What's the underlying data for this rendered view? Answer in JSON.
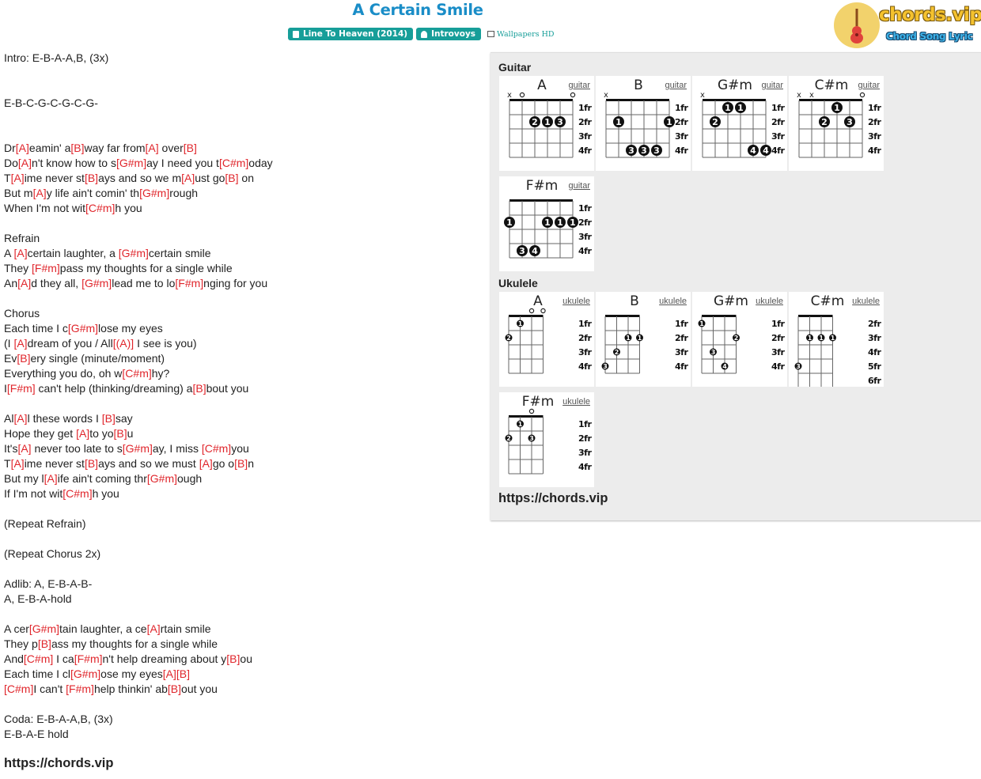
{
  "page": {
    "title": "A Certain Smile",
    "album": "Line To Heaven (2014)",
    "artist": "Introvoys",
    "wallpapers": "Wallpapers HD"
  },
  "brand": {
    "logo_text": "chords.vip",
    "tagline": "Chord Song Lyric"
  },
  "lyrics": [
    [
      [
        "Intro: E-B-A-A,B, (3x)",
        0
      ]
    ],
    [],
    [],
    [
      [
        "E-B-C-G-C-G-C-G-",
        0
      ]
    ],
    [],
    [],
    [
      [
        "Dr",
        0
      ],
      [
        "[A]",
        1
      ],
      [
        "eamin' a",
        0
      ],
      [
        "[B]",
        1
      ],
      [
        "way far from",
        0
      ],
      [
        "[A]",
        1
      ],
      [
        " over",
        0
      ],
      [
        "[B]",
        1
      ]
    ],
    [
      [
        "Do",
        0
      ],
      [
        "[A]",
        1
      ],
      [
        "n't know how to s",
        0
      ],
      [
        "[G#m]",
        1
      ],
      [
        "ay I need you t",
        0
      ],
      [
        "[C#m]",
        1
      ],
      [
        "oday",
        0
      ]
    ],
    [
      [
        "T",
        0
      ],
      [
        "[A]",
        1
      ],
      [
        "ime never st",
        0
      ],
      [
        "[B]",
        1
      ],
      [
        "ays and so we m",
        0
      ],
      [
        "[A]",
        1
      ],
      [
        "ust go",
        0
      ],
      [
        "[B]",
        1
      ],
      [
        " on",
        0
      ]
    ],
    [
      [
        "But m",
        0
      ],
      [
        "[A]",
        1
      ],
      [
        "y life ain't comin' th",
        0
      ],
      [
        "[G#m]",
        1
      ],
      [
        "rough",
        0
      ]
    ],
    [
      [
        "When I'm not wit",
        0
      ],
      [
        "[C#m]",
        1
      ],
      [
        "h you",
        0
      ]
    ],
    [],
    [
      [
        "Refrain",
        0
      ]
    ],
    [
      [
        "A ",
        0
      ],
      [
        "[A]",
        1
      ],
      [
        "certain laughter, a ",
        0
      ],
      [
        "[G#m]",
        1
      ],
      [
        "certain smile",
        0
      ]
    ],
    [
      [
        "They ",
        0
      ],
      [
        "[F#m]",
        1
      ],
      [
        "pass my thoughts for a single while",
        0
      ]
    ],
    [
      [
        "An",
        0
      ],
      [
        "[A]",
        1
      ],
      [
        "d they all, ",
        0
      ],
      [
        "[G#m]",
        1
      ],
      [
        "lead me to lo",
        0
      ],
      [
        "[F#m]",
        1
      ],
      [
        "nging for you",
        0
      ]
    ],
    [],
    [
      [
        "Chorus",
        0
      ]
    ],
    [
      [
        "Each time I c",
        0
      ],
      [
        "[G#m]",
        1
      ],
      [
        "lose my eyes",
        0
      ]
    ],
    [
      [
        "(I ",
        0
      ],
      [
        "[A]",
        1
      ],
      [
        "dream of you / All",
        0
      ],
      [
        "[(A)]",
        1
      ],
      [
        " I see is you)",
        0
      ]
    ],
    [
      [
        "Ev",
        0
      ],
      [
        "[B]",
        1
      ],
      [
        "ery single (minute/moment)",
        0
      ]
    ],
    [
      [
        "Everything you do, oh w",
        0
      ],
      [
        "[C#m]",
        1
      ],
      [
        "hy?",
        0
      ]
    ],
    [
      [
        "I",
        0
      ],
      [
        "[F#m]",
        1
      ],
      [
        " can't help (thinking/dreaming) a",
        0
      ],
      [
        "[B]",
        1
      ],
      [
        "bout you",
        0
      ]
    ],
    [],
    [
      [
        "Al",
        0
      ],
      [
        "[A]",
        1
      ],
      [
        "l these words I ",
        0
      ],
      [
        "[B]",
        1
      ],
      [
        "say",
        0
      ]
    ],
    [
      [
        "Hope they get ",
        0
      ],
      [
        "[A]",
        1
      ],
      [
        "to yo",
        0
      ],
      [
        "[B]",
        1
      ],
      [
        "u",
        0
      ]
    ],
    [
      [
        "It's",
        0
      ],
      [
        "[A]",
        1
      ],
      [
        " never too late to s",
        0
      ],
      [
        "[G#m]",
        1
      ],
      [
        "ay, I miss ",
        0
      ],
      [
        "[C#m]",
        1
      ],
      [
        "you",
        0
      ]
    ],
    [
      [
        "T",
        0
      ],
      [
        "[A]",
        1
      ],
      [
        "ime never st",
        0
      ],
      [
        "[B]",
        1
      ],
      [
        "ays and so we must ",
        0
      ],
      [
        "[A]",
        1
      ],
      [
        "go o",
        0
      ],
      [
        "[B]",
        1
      ],
      [
        "n",
        0
      ]
    ],
    [
      [
        "But my l",
        0
      ],
      [
        "[A]",
        1
      ],
      [
        "ife ain't coming thr",
        0
      ],
      [
        "[G#m]",
        1
      ],
      [
        "ough",
        0
      ]
    ],
    [
      [
        "If I'm not wit",
        0
      ],
      [
        "[C#m]",
        1
      ],
      [
        "h you",
        0
      ]
    ],
    [],
    [
      [
        "(Repeat Refrain)",
        0
      ]
    ],
    [],
    [
      [
        "(Repeat Chorus 2x)",
        0
      ]
    ],
    [],
    [
      [
        "Adlib: A, E-B-A-B-",
        0
      ]
    ],
    [
      [
        "A, E-B-A-hold",
        0
      ]
    ],
    [],
    [
      [
        "A cer",
        0
      ],
      [
        "[G#m]",
        1
      ],
      [
        "tain laughter, a ce",
        0
      ],
      [
        "[A]",
        1
      ],
      [
        "rtain smile",
        0
      ]
    ],
    [
      [
        "They p",
        0
      ],
      [
        "[B]",
        1
      ],
      [
        "ass my thoughts for a single while",
        0
      ]
    ],
    [
      [
        "And",
        0
      ],
      [
        "[C#m]",
        1
      ],
      [
        " I ca",
        0
      ],
      [
        "[F#m]",
        1
      ],
      [
        "n't help dreaming about y",
        0
      ],
      [
        "[B]",
        1
      ],
      [
        "ou",
        0
      ]
    ],
    [
      [
        "Each time I cl",
        0
      ],
      [
        "[G#m]",
        1
      ],
      [
        "ose my eyes",
        0
      ],
      [
        "[A]",
        1
      ],
      [
        "[B]",
        1
      ]
    ],
    [
      [
        "[C#m]",
        1
      ],
      [
        "I can't ",
        0
      ],
      [
        "[F#m]",
        1
      ],
      [
        "help thinkin' ab",
        0
      ],
      [
        "[B]",
        1
      ],
      [
        "out you",
        0
      ]
    ],
    [],
    [
      [
        "Coda: E-B-A-A,B, (3x)",
        0
      ]
    ],
    [
      [
        "E-B-A-E hold",
        0
      ]
    ]
  ],
  "lyrics_footer": "https://chords.vip",
  "panel": {
    "guitar_title": "Guitar",
    "ukulele_title": "Ukulele",
    "footer": "https://chords.vip",
    "guitar": [
      {
        "name": "A",
        "link": "guitar",
        "frets": [
          "1fr",
          "2fr",
          "3fr",
          "4fr"
        ],
        "top": [
          "x",
          "o",
          "",
          "",
          "",
          "o"
        ],
        "dots": [
          [
            3,
            2,
            "2"
          ],
          [
            4,
            2,
            "1"
          ],
          [
            5,
            2,
            "3"
          ]
        ],
        "barre": null
      },
      {
        "name": "B",
        "link": "guitar",
        "frets": [
          "1fr",
          "2fr",
          "3fr",
          "4fr"
        ],
        "top": [
          "x",
          "",
          "",
          "",
          "",
          ""
        ],
        "dots": [
          [
            2,
            2,
            "1"
          ],
          [
            6,
            2,
            "1"
          ],
          [
            3,
            4,
            "3"
          ],
          [
            4,
            4,
            "3"
          ],
          [
            5,
            4,
            "3"
          ]
        ],
        "barre": null
      },
      {
        "name": "G#m",
        "link": "guitar",
        "frets": [
          "1fr",
          "2fr",
          "3fr",
          "4fr"
        ],
        "top": [
          "x",
          "",
          "",
          "",
          "",
          ""
        ],
        "dots": [
          [
            3,
            1,
            "1"
          ],
          [
            4,
            1,
            "1"
          ],
          [
            2,
            2,
            "2"
          ],
          [
            5,
            4,
            "4"
          ],
          [
            6,
            4,
            "4"
          ]
        ],
        "barre": null
      },
      {
        "name": "C#m",
        "link": "guitar",
        "frets": [
          "1fr",
          "2fr",
          "3fr",
          "4fr"
        ],
        "top": [
          "x",
          "x",
          "",
          "",
          "",
          "o"
        ],
        "dots": [
          [
            4,
            1,
            "1"
          ],
          [
            3,
            2,
            "2"
          ],
          [
            5,
            2,
            "3"
          ]
        ],
        "barre": null
      },
      {
        "name": "F#m",
        "link": "guitar",
        "frets": [
          "1fr",
          "2fr",
          "3fr",
          "4fr"
        ],
        "top": [
          "",
          "",
          "",
          "",
          "",
          ""
        ],
        "dots": [
          [
            1,
            2,
            "1"
          ],
          [
            4,
            2,
            "1"
          ],
          [
            5,
            2,
            "1"
          ],
          [
            6,
            2,
            "1"
          ],
          [
            2,
            4,
            "3"
          ],
          [
            3,
            4,
            "4"
          ]
        ],
        "barre": null
      }
    ],
    "ukulele": [
      {
        "name": "A",
        "link": "ukulele",
        "frets": [
          "1fr",
          "2fr",
          "3fr",
          "4fr"
        ],
        "top": [
          "",
          "",
          "o",
          "o"
        ],
        "dots": [
          [
            2,
            1,
            "1"
          ],
          [
            1,
            2,
            "2"
          ]
        ]
      },
      {
        "name": "B",
        "link": "ukulele",
        "frets": [
          "1fr",
          "2fr",
          "3fr",
          "4fr"
        ],
        "top": [
          "",
          "",
          "",
          ""
        ],
        "dots": [
          [
            3,
            2,
            "1"
          ],
          [
            4,
            2,
            "1"
          ],
          [
            2,
            3,
            "2"
          ],
          [
            1,
            4,
            "3"
          ]
        ]
      },
      {
        "name": "G#m",
        "link": "ukulele",
        "frets": [
          "1fr",
          "2fr",
          "3fr",
          "4fr"
        ],
        "top": [
          "",
          "",
          "",
          ""
        ],
        "dots": [
          [
            1,
            1,
            "1"
          ],
          [
            4,
            2,
            "2"
          ],
          [
            2,
            3,
            "3"
          ],
          [
            3,
            4,
            "4"
          ]
        ]
      },
      {
        "name": "C#m",
        "link": "ukulele",
        "frets": [
          "2fr",
          "3fr",
          "4fr",
          "5fr",
          "6fr"
        ],
        "top": [
          "",
          "",
          "",
          ""
        ],
        "dots": [
          [
            2,
            2,
            "1"
          ],
          [
            3,
            2,
            "1"
          ],
          [
            4,
            2,
            "1"
          ],
          [
            1,
            4,
            "3"
          ]
        ]
      },
      {
        "name": "F#m",
        "link": "ukulele",
        "frets": [
          "1fr",
          "2fr",
          "3fr",
          "4fr"
        ],
        "top": [
          "",
          "",
          "o",
          ""
        ],
        "dots": [
          [
            2,
            1,
            "1"
          ],
          [
            1,
            2,
            "2"
          ],
          [
            3,
            2,
            "3"
          ]
        ]
      }
    ]
  },
  "colors": {
    "title": "#1a8dc7",
    "badge": "#179e99",
    "chord": "#e0262c",
    "panel": "#ececec"
  }
}
